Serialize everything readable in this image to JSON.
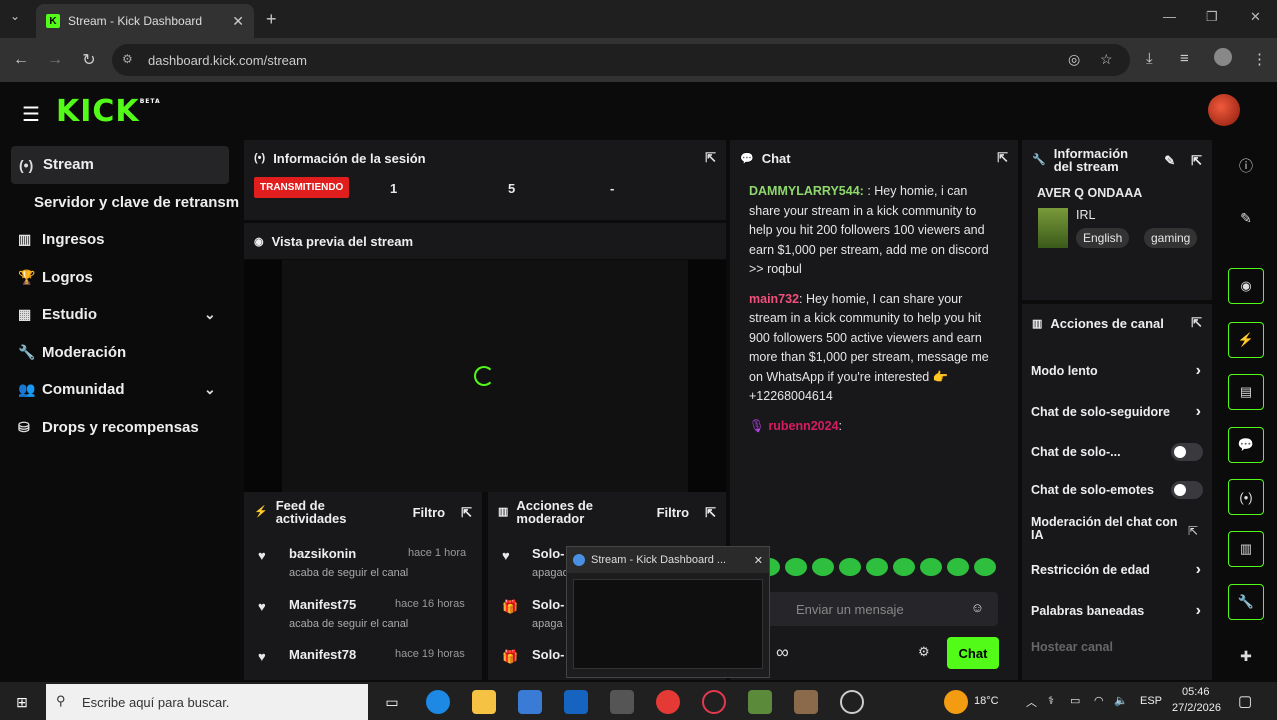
{
  "browser": {
    "tab_title": "Stream - Kick Dashboard",
    "tab_fav": "K",
    "url": "dashboard.kick.com/stream",
    "new_tab": "+",
    "close_tab": "✕",
    "tab_menu": "⌄",
    "min": "—",
    "restore": "❐",
    "close": "✕",
    "back": "←",
    "forward": "→",
    "reload": "↻",
    "menu": "⋮"
  },
  "app": {
    "logo": "KICK",
    "logo_sup": "BETA"
  },
  "nav": {
    "items": [
      {
        "icon": "(•)",
        "label": "Stream"
      },
      {
        "label": "Servidor y clave de retransmisión"
      },
      {
        "icon": "▥",
        "label": "Ingresos"
      },
      {
        "icon": "🏆",
        "label": "Logros"
      },
      {
        "icon": "▦",
        "label": "Estudio",
        "chev": "⌄"
      },
      {
        "icon": "🔧",
        "label": "Moderación"
      },
      {
        "icon": "👥",
        "label": "Comunidad",
        "chev": "⌄"
      },
      {
        "icon": "⛁",
        "label": "Drops y recompensas"
      }
    ]
  },
  "session": {
    "title": "Información de la sesión",
    "status": "TRANSMITIENDO",
    "stat1": "1",
    "stat2": "5",
    "stat3": "-"
  },
  "preview": {
    "title": "Vista previa del stream"
  },
  "chat": {
    "title": "Chat",
    "messages": [
      {
        "user": "DAMMYLARRY544:",
        "text": ": Hey homie, i can share your stream in a kick community to help you hit 200 followers 100 viewers and earn $1,000 per stream, add me on discord >> roqbul",
        "color": "#8fd86b"
      },
      {
        "user": "main732",
        "text": ": Hey homie, I can share your stream in a kick community to help you hit 900 followers 500 active viewers and earn more than $1,000 per stream, message me on WhatsApp if you're interested 👉 +12268004614",
        "color": "#f0507a"
      },
      {
        "user": "rubenn2024",
        "text": ":",
        "color": "#d81b60"
      }
    ],
    "placeholder": "Enviar un mensaje",
    "send": "Chat",
    "infinity": "∞"
  },
  "stream_info": {
    "title": "Información del stream",
    "stream_title": "AVER Q ONDAAA",
    "category": "IRL",
    "tags": [
      "English",
      "gaming"
    ]
  },
  "channel_actions": {
    "title": "Acciones de canal",
    "items": [
      {
        "label": "Modo lento",
        "kind": "chevron"
      },
      {
        "label": "Chat de solo-seguidore",
        "kind": "chevron"
      },
      {
        "label": "Chat de solo-...",
        "kind": "toggle"
      },
      {
        "label": "Chat de solo-emotes",
        "kind": "toggle"
      },
      {
        "label": "Moderación del chat con IA",
        "kind": "external"
      },
      {
        "label": "Restricción de edad",
        "kind": "chevron"
      },
      {
        "label": "Palabras baneadas",
        "kind": "chevron"
      },
      {
        "label": "Hostear canal",
        "kind": "disabled"
      }
    ]
  },
  "activity": {
    "title": "Feed de actividades",
    "filter": "Filtro",
    "items": [
      {
        "name": "bazsikonin",
        "time": "hace 1 hora",
        "sub": "acaba de seguir el canal"
      },
      {
        "name": "Manifest75",
        "time": "hace 16 horas",
        "sub": "acaba de seguir el canal"
      },
      {
        "name": "Manifest78",
        "time": "hace 19 horas",
        "sub": ""
      }
    ]
  },
  "modactions": {
    "title": "Acciones de moderador",
    "filter": "Filtro",
    "items": [
      {
        "name": "Solo-",
        "sub": "apagad"
      },
      {
        "name": "Solo-",
        "sub": "apaga"
      },
      {
        "name": "Solo-",
        "sub": ""
      }
    ]
  },
  "thumbnail": {
    "title": "Stream - Kick Dashboard ...",
    "close": "✕"
  },
  "taskbar": {
    "search": "Escribe aquí para buscar.",
    "temp": "18°C",
    "lang": "ESP",
    "time": "05:46",
    "date": "27/2/2026"
  }
}
